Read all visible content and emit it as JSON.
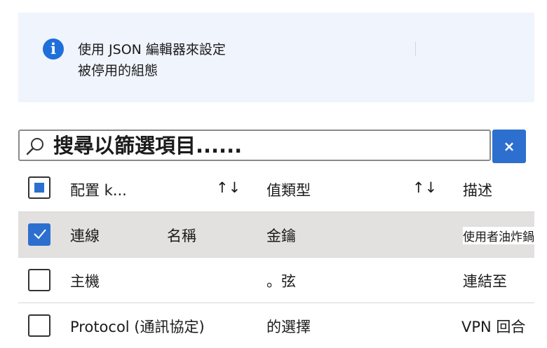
{
  "banner": {
    "line1": "使用 JSON 編輯器來設定",
    "line2": "被停用的組態"
  },
  "search": {
    "placeholder": "搜尋以篩選項目......"
  },
  "clear_button_label": "×",
  "table": {
    "headers": {
      "key": "配置 k...",
      "value_type": "值類型",
      "description": "描述"
    },
    "sort_glyph": "↑↓",
    "rows": [
      {
        "c1": "連線",
        "c2": "名稱",
        "c3": "金鑰",
        "c4": "使用者油炸鍋",
        "checked": true
      },
      {
        "c1": "主機",
        "c2": "",
        "c3": "。弦",
        "c4": "連結至",
        "checked": false
      },
      {
        "c1": "Protocol (通訊協定)",
        "c2": "",
        "c3": "的選擇",
        "c4": "VPN 回合",
        "checked": false
      }
    ]
  },
  "colors": {
    "accent": "#2d6fcf",
    "banner_bg": "#f0f4fc",
    "selected_row": "#e3e1e0"
  }
}
